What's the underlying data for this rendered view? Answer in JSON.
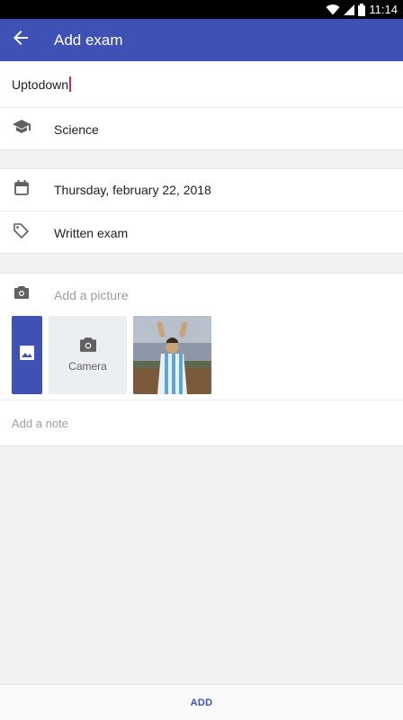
{
  "status_bar": {
    "time": "11:14"
  },
  "app_bar": {
    "title": "Add exam",
    "back_icon": "arrow-back-icon"
  },
  "form": {
    "name_value": "Uptodown",
    "subject": {
      "icon": "school-icon",
      "label": "Science"
    },
    "date": {
      "icon": "calendar-icon",
      "label": "Thursday, february 22, 2018"
    },
    "type": {
      "icon": "tag-icon",
      "label": "Written exam"
    },
    "picture": {
      "icon": "camera-icon",
      "placeholder": "Add a picture",
      "gallery_icon": "image-icon",
      "camera_label": "Camera"
    },
    "note_placeholder": "Add a note"
  },
  "bottom_bar": {
    "add_label": "ADD"
  },
  "colors": {
    "primary": "#3f51b5",
    "caret": "#e91e63"
  }
}
